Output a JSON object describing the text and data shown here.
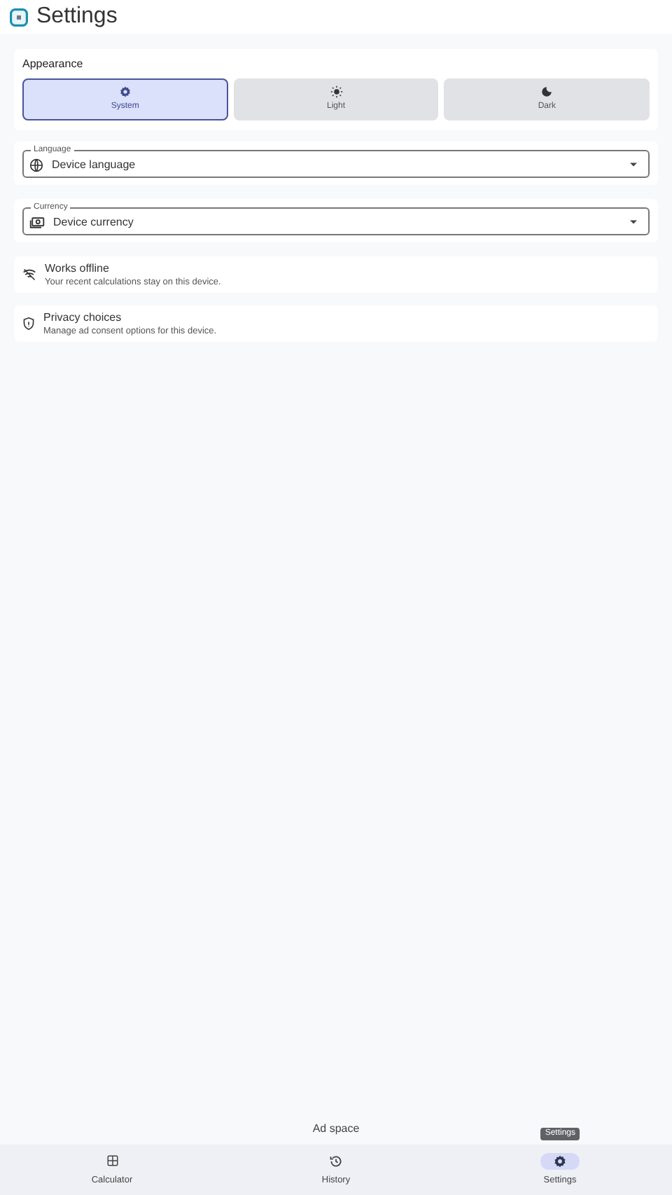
{
  "app_bar": {
    "title": "Settings"
  },
  "appearance": {
    "heading": "Appearance",
    "options": [
      {
        "label": "System",
        "kind": "system",
        "selected": true
      },
      {
        "label": "Light",
        "kind": "light",
        "selected": false
      },
      {
        "label": "Dark",
        "kind": "dark",
        "selected": false
      }
    ]
  },
  "selects": [
    {
      "kind": "language",
      "label": "Language",
      "value": "Device language"
    },
    {
      "kind": "currency",
      "label": "Currency",
      "value": "Device currency"
    }
  ],
  "info": [
    {
      "kind": "offline",
      "title": "Works offline",
      "subtitle": "Your recent calculations stay on this device."
    },
    {
      "kind": "privacy",
      "title": "Privacy choices",
      "subtitle": "Manage ad consent options for this device."
    }
  ],
  "ad": "Ad space",
  "tooltip": "Settings",
  "nav": [
    {
      "label": "Calculator",
      "kind": "calculator",
      "selected": false
    },
    {
      "label": "History",
      "kind": "history",
      "selected": false
    },
    {
      "label": "Settings",
      "kind": "settings",
      "selected": true
    }
  ]
}
